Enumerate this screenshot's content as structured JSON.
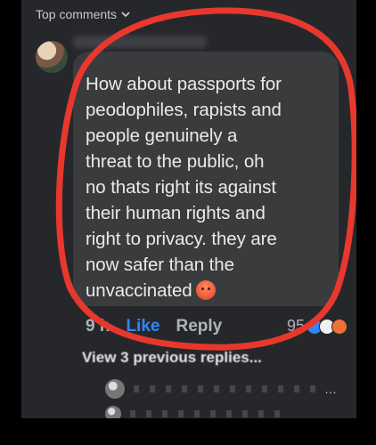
{
  "header": {
    "sort_label": "Top comments"
  },
  "comment": {
    "text": "How about passports for\npeodophiles, rapists and\npeople genuinely a\nthreat to the public, oh\nno thats right its against\ntheir human rights and\nright to privacy. they are\nnow safer than the\nunvaccinated",
    "time": "9 h",
    "like_label": "Like",
    "reply_label": "Reply",
    "reaction_count": "95"
  },
  "replies": {
    "view_previous_label": "View 3 previous replies..."
  },
  "colors": {
    "annotation": "#e8382e",
    "like_blue": "#2d88ff",
    "background": "#26272b"
  }
}
